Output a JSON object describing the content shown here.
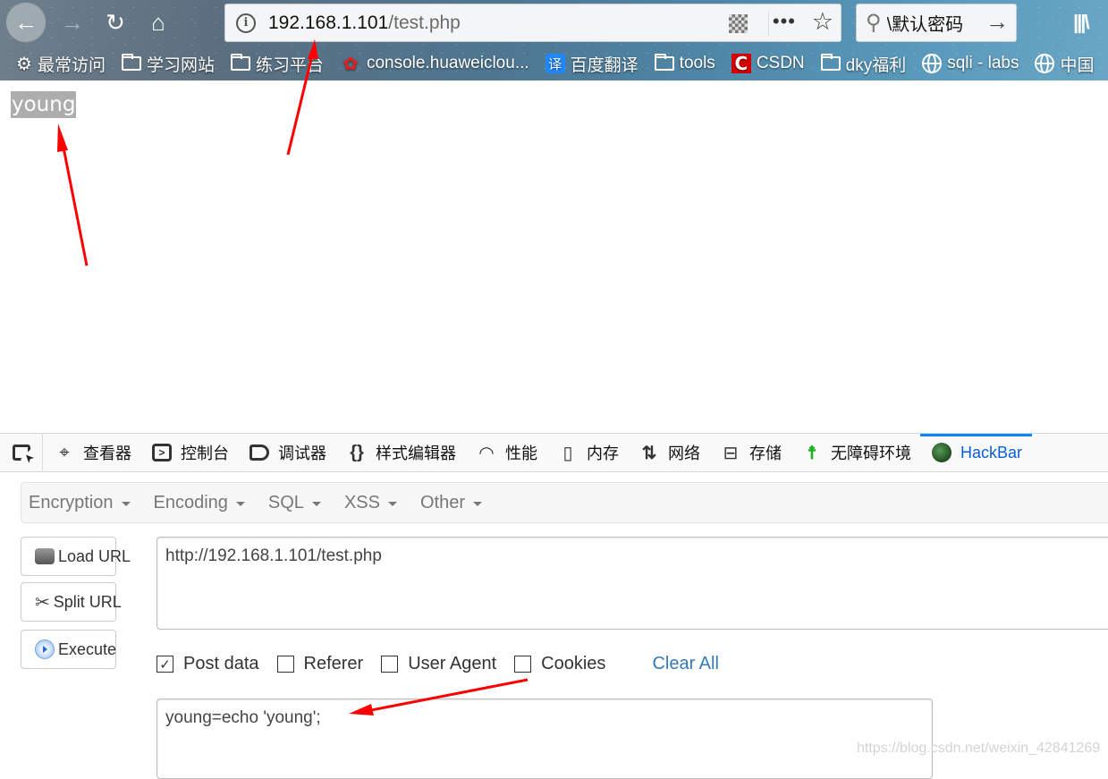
{
  "browser": {
    "nav": {
      "back_icon": "arrow-left-icon",
      "forward_icon": "arrow-right-icon",
      "reload_icon": "reload-icon",
      "home_icon": "home-icon"
    },
    "url_bar": {
      "host": "192.168.1.101",
      "path": "/test.php",
      "page_actions_icon": "ellipsis-icon",
      "bookmark_icon": "star-icon",
      "qr_icon": "qr-code-icon",
      "info_icon": "info-icon"
    },
    "search_bar": {
      "query": "\\默认密码",
      "search_icon": "magnifier-icon",
      "go_icon": "arrow-right-icon"
    },
    "library_icon": "library-icon",
    "bookmarks": [
      {
        "label": "最常访问",
        "icon": "gear-icon"
      },
      {
        "label": "学习网站",
        "icon": "folder-icon"
      },
      {
        "label": "练习平台",
        "icon": "folder-icon"
      },
      {
        "label": "console.huaweiclou...",
        "icon": "huawei-logo-icon"
      },
      {
        "label": "百度翻译",
        "icon": "baidu-translate-icon",
        "glyph": "译"
      },
      {
        "label": "tools",
        "icon": "folder-icon"
      },
      {
        "label": "CSDN",
        "icon": "csdn-logo-icon",
        "glyph": "C"
      },
      {
        "label": "dky福利",
        "icon": "folder-icon"
      },
      {
        "label": "sqli - labs",
        "icon": "globe-icon"
      },
      {
        "label": "中国",
        "icon": "globe-icon"
      }
    ]
  },
  "page": {
    "output_text": "young"
  },
  "devtools": {
    "tabs": [
      {
        "label": "查看器",
        "icon": "inspector-icon"
      },
      {
        "label": "控制台",
        "icon": "console-icon"
      },
      {
        "label": "调试器",
        "icon": "debugger-icon"
      },
      {
        "label": "样式编辑器",
        "icon": "braces-icon"
      },
      {
        "label": "性能",
        "icon": "gauge-icon"
      },
      {
        "label": "内存",
        "icon": "memory-chip-icon"
      },
      {
        "label": "网络",
        "icon": "network-arrows-icon"
      },
      {
        "label": "存储",
        "icon": "storage-icon"
      },
      {
        "label": "无障碍环境",
        "icon": "accessibility-icon"
      },
      {
        "label": "HackBar",
        "icon": "hackbar-icon",
        "active": true
      }
    ],
    "accent_color": "#0a84ff"
  },
  "hackbar": {
    "menu": [
      "Encryption",
      "Encoding",
      "SQL",
      "XSS",
      "Other"
    ],
    "buttons": {
      "load_url": "Load URL",
      "split_url": "Split URL",
      "execute": "Execute"
    },
    "url_value": "http://192.168.1.101/test.php",
    "options": [
      {
        "label": "Post data",
        "checked": true
      },
      {
        "label": "Referer",
        "checked": false
      },
      {
        "label": "User Agent",
        "checked": false
      },
      {
        "label": "Cookies",
        "checked": false
      }
    ],
    "clear_all": "Clear All",
    "post_data_value": "young=echo 'young';",
    "link_color": "#337ab7"
  },
  "watermark": "https://blog.csdn.net/weixin_42841269",
  "annotation_color": "#ff0000"
}
